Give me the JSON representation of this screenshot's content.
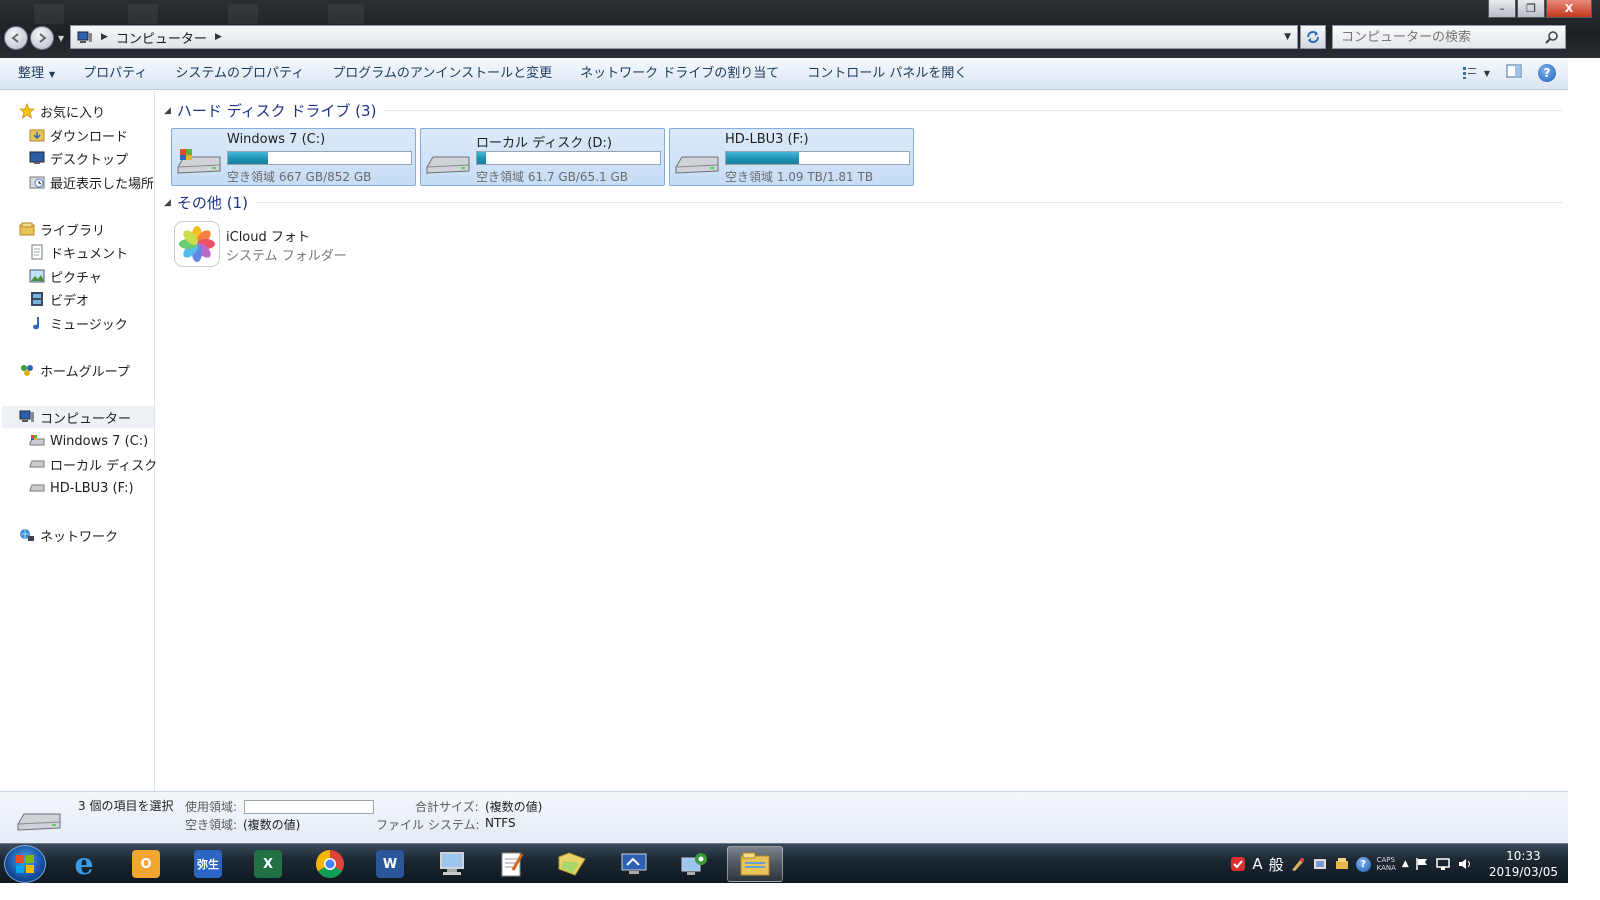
{
  "window": {
    "breadcrumb": "コンピューター",
    "search_placeholder": "コンピューターの検索",
    "min_glyph": "–",
    "max_glyph": "❐",
    "close_glyph": "X"
  },
  "toolbar": {
    "organize": "整理",
    "properties": "プロパティ",
    "system_properties": "システムのプロパティ",
    "uninstall": "プログラムのアンインストールと変更",
    "map_drive": "ネットワーク ドライブの割り当て",
    "control_panel": "コントロール パネルを開く"
  },
  "sidebar": {
    "favorites": {
      "label": "お気に入り",
      "items": [
        "ダウンロード",
        "デスクトップ",
        "最近表示した場所"
      ]
    },
    "libraries": {
      "label": "ライブラリ",
      "items": [
        "ドキュメント",
        "ピクチャ",
        "ビデオ",
        "ミュージック"
      ]
    },
    "homegroup": "ホームグループ",
    "computer": {
      "label": "コンピューター",
      "items": [
        "Windows 7 (C:)",
        "ローカル ディスク (",
        "HD-LBU3 (F:)"
      ]
    },
    "network": "ネットワーク"
  },
  "groups": {
    "hard_disks": "ハード ディスク ドライブ (3)",
    "other": "その他 (1)"
  },
  "drives": [
    {
      "name": "Windows 7 (C:)",
      "free": "空き領域 667 GB/852 GB",
      "used_fraction": 0.22
    },
    {
      "name": "ローカル ディスク (D:)",
      "free": "空き領域 61.7 GB/65.1 GB",
      "used_fraction": 0.05
    },
    {
      "name": "HD-LBU3 (F:)",
      "free": "空き領域 1.09 TB/1.81 TB",
      "used_fraction": 0.4
    }
  ],
  "other_items": [
    {
      "name": "iCloud フォト",
      "subtitle": "システム フォルダー"
    }
  ],
  "details": {
    "selected": "3 個の項目を選択",
    "used_label": "使用領域:",
    "free_label": "空き領域:",
    "free_value": "(複数の値)",
    "total_label": "合計サイズ:",
    "total_value": "(複数の値)",
    "fs_label": "ファイル システム:",
    "fs_value": "NTFS"
  },
  "taskbar": {
    "apps": [
      "internet-explorer",
      "outlook",
      "yayoi",
      "excel",
      "chrome",
      "word",
      "computer",
      "notepad",
      "folder",
      "remote-desktop",
      "network-setup",
      "explorer"
    ],
    "yayoi_label": "弥生",
    "excel_label": "X",
    "word_label": "W",
    "ie_label": "e",
    "outlook_label": "O",
    "ime_mode": "A",
    "ime_kanji": "般",
    "caps": "CAPS",
    "kana": "KANA",
    "time": "10:33",
    "date": "2019/03/05"
  },
  "colors": {
    "drive_fill": "#1e8fb3",
    "group_header": "#1e3287",
    "selection_bg": "#c6ddf6"
  }
}
